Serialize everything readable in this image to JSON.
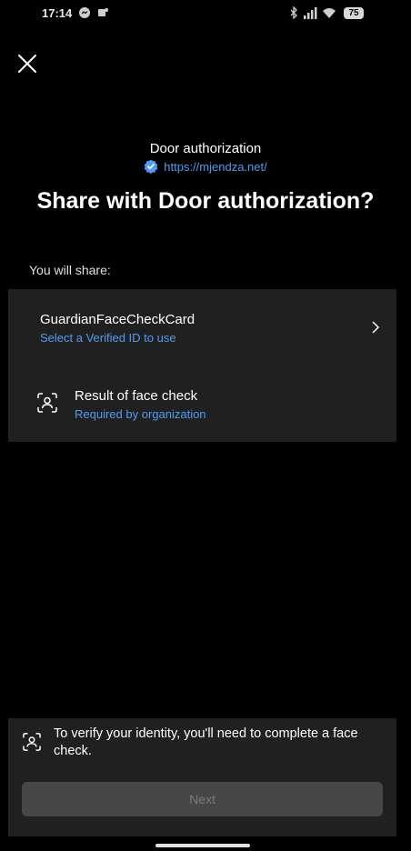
{
  "status_bar": {
    "time": "17:14",
    "battery": "75",
    "icons": [
      "messenger-icon",
      "teams-icon",
      "bluetooth-icon",
      "signal-icon",
      "wifi-icon",
      "battery-icon"
    ]
  },
  "header": {
    "close_icon": "close-icon",
    "rp_name": "Door authorization",
    "rp_domain": "https://mjendza.net/",
    "verified_icon": "verified-badge-icon",
    "title": "Share with Door authorization?"
  },
  "share": {
    "label": "You will share:",
    "credential": {
      "name": "GuardianFaceCheckCard",
      "subtitle": "Select a Verified ID to use"
    },
    "face_check": {
      "icon": "face-scan-icon",
      "title": "Result of face check",
      "subtitle": "Required by organization"
    }
  },
  "footer": {
    "notice": "To verify your identity, you'll need to complete a face check.",
    "next_label": "Next"
  },
  "colors": {
    "background": "#000000",
    "card": "#202020",
    "accent_link": "#4f9cf2",
    "button_disabled": "#474747"
  }
}
